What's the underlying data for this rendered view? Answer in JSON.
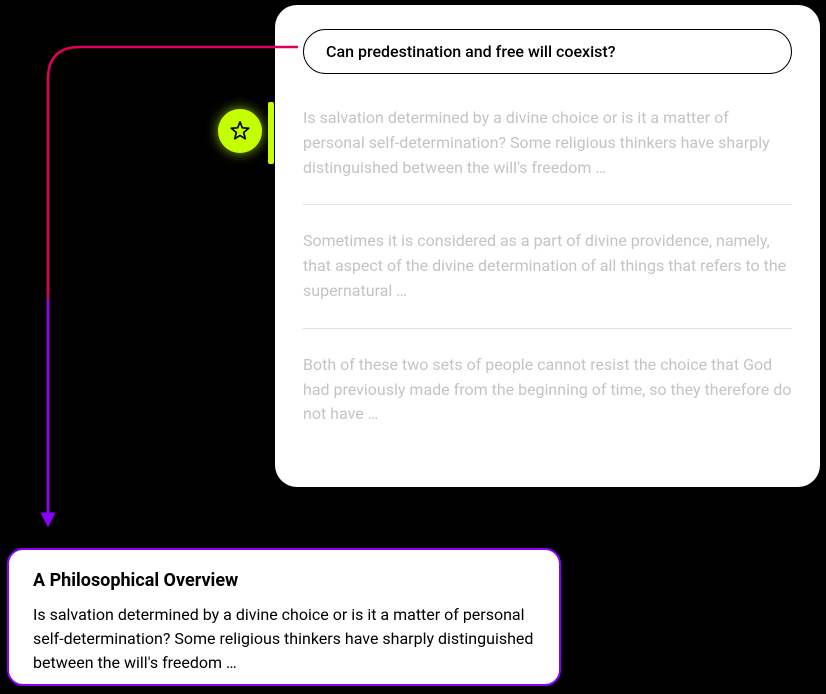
{
  "query": "Can predestination and free will coexist?",
  "results": [
    "Is salvation determined by a divine choice or is it a matter of personal self-determination? Some religious thinkers have sharply distinguished between the will's freedom …",
    "Sometimes it is considered as a part of divine providence, namely, that aspect of the divine determination of all things that refers to the supernatural …",
    "Both of these two sets of people cannot resist the choice that God had previously made from the beginning of time, so they therefore do not have …"
  ],
  "detail": {
    "title": "A Philosophical Overview",
    "body": "Is salvation determined by a divine choice or is it a matter of personal self-determination? Some religious thinkers have sharply distinguished between the will's freedom …"
  },
  "colors": {
    "accent_purple": "#8a00ff",
    "accent_pink": "#e0005a",
    "accent_lime": "#c4ff00"
  }
}
